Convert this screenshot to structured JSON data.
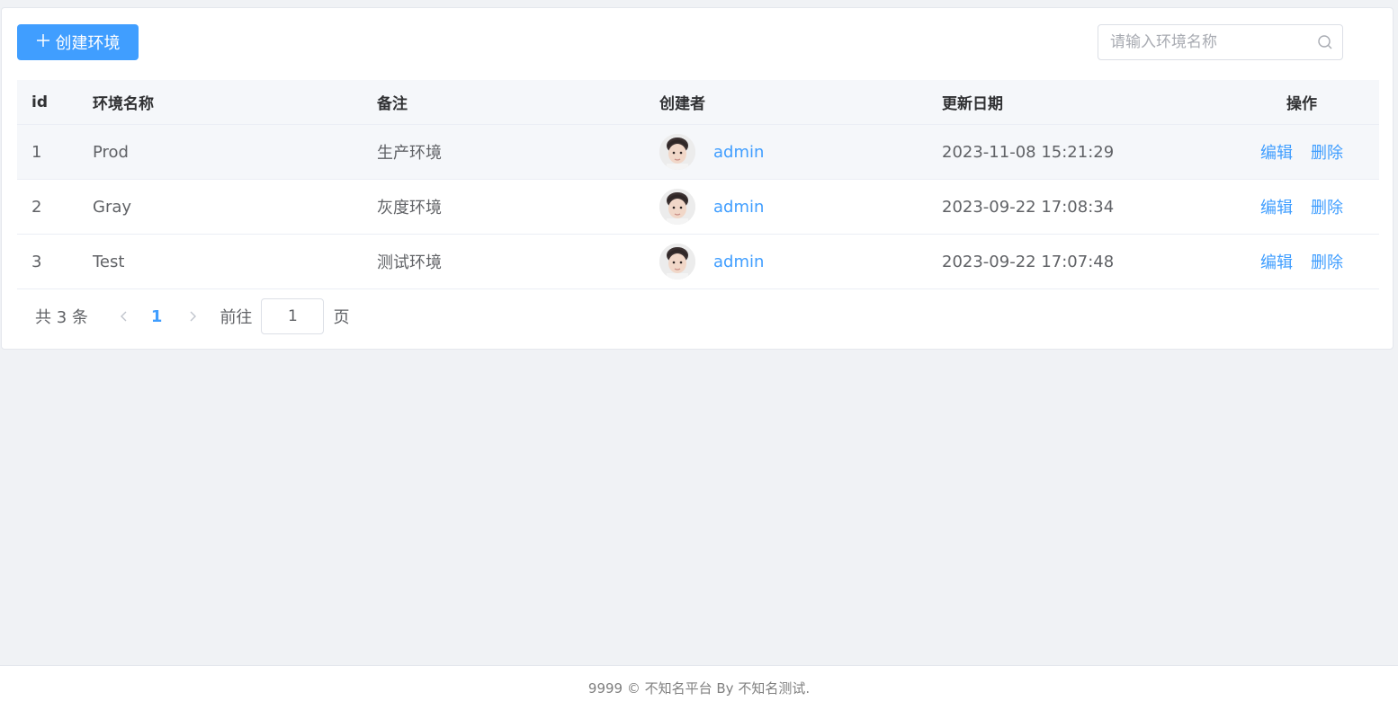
{
  "toolbar": {
    "create_label": "创建环境",
    "search_placeholder": "请输入环境名称"
  },
  "table": {
    "columns": [
      "id",
      "环境名称",
      "备注",
      "创建者",
      "更新日期",
      "操作"
    ],
    "rows": [
      {
        "id": "1",
        "name": "Prod",
        "note": "生产环境",
        "creator": "admin",
        "date": "2023-11-08 15:21:29",
        "edit": "编辑",
        "delete": "删除"
      },
      {
        "id": "2",
        "name": "Gray",
        "note": "灰度环境",
        "creator": "admin",
        "date": "2023-09-22 17:08:34",
        "edit": "编辑",
        "delete": "删除"
      },
      {
        "id": "3",
        "name": "Test",
        "note": "测试环境",
        "creator": "admin",
        "date": "2023-09-22 17:07:48",
        "edit": "编辑",
        "delete": "删除"
      }
    ]
  },
  "pagination": {
    "total_label": "共 3 条",
    "current_page": "1",
    "goto_label": "前往",
    "jump_value": "1",
    "page_suffix": "页"
  },
  "footer": {
    "text": "9999 © 不知名平台 By 不知名测试."
  },
  "colors": {
    "primary": "#409eff",
    "background": "#f0f2f5"
  },
  "icons": {
    "create": "plus-icon",
    "search": "search-icon",
    "prev": "chevron-left-icon",
    "next": "chevron-right-icon"
  }
}
